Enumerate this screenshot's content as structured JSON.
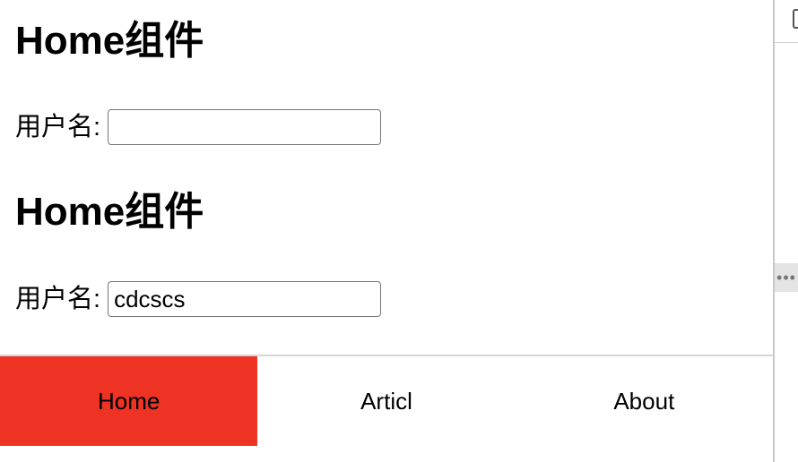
{
  "sections": [
    {
      "title": "Home组件",
      "label": "用户名:",
      "input_value": ""
    },
    {
      "title": "Home组件",
      "label": "用户名:",
      "input_value": "cdcscs"
    }
  ],
  "tabbar": {
    "tabs": [
      {
        "label": "Home",
        "active": true
      },
      {
        "label": "Articl",
        "active": false
      },
      {
        "label": "About",
        "active": false
      }
    ],
    "active_color": "#ee3325"
  },
  "devtools": {
    "handle_glyph": "•••"
  }
}
